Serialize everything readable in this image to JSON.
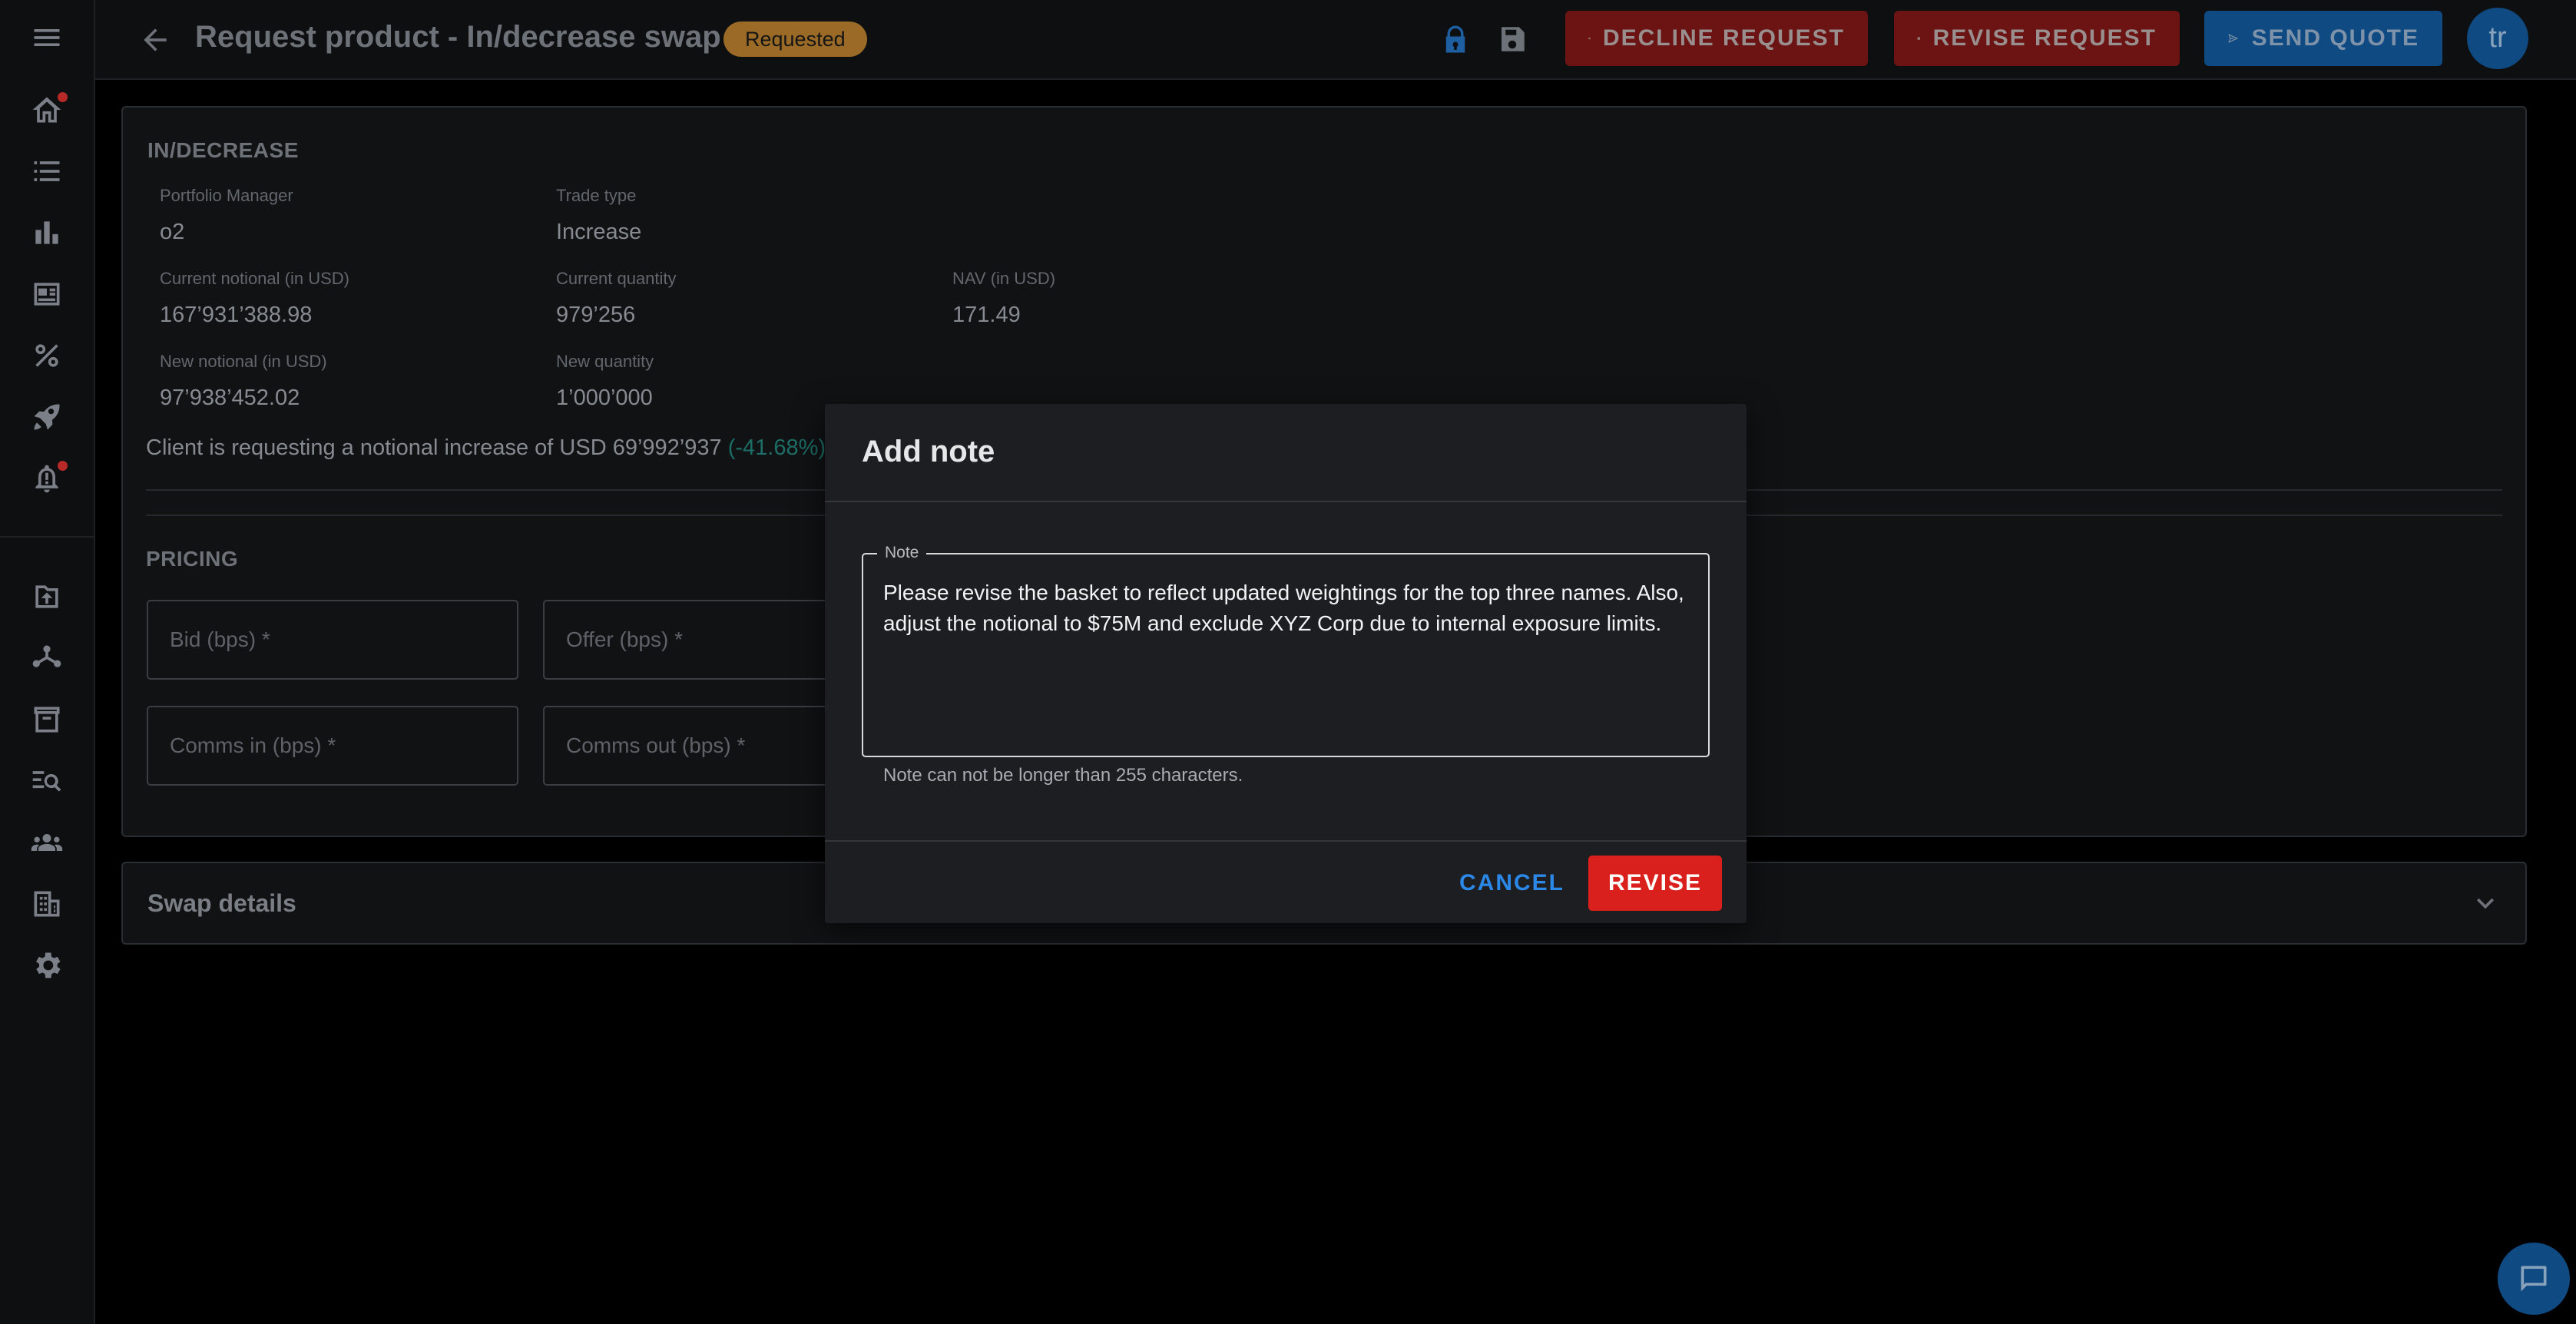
{
  "header": {
    "title": "Request product - In/decrease swap",
    "status": "Requested",
    "decline_label": "DECLINE REQUEST",
    "revise_label": "REVISE REQUEST",
    "send_label": "SEND QUOTE",
    "avatar_initials": "tr"
  },
  "sidebar": {
    "icons": [
      "menu-icon",
      "home-icon",
      "list-icon",
      "bar-chart-icon",
      "newspaper-icon",
      "percent-icon",
      "rocket-icon",
      "bell-icon",
      "upload-icon",
      "network-icon",
      "archive-icon",
      "search-list-icon",
      "groups-icon",
      "building-icon",
      "gear-icon"
    ]
  },
  "indecrease": {
    "section_title": "IN/DECREASE",
    "pm_label": "Portfolio Manager",
    "pm_value": "o2",
    "trade_type_label": "Trade type",
    "trade_type_value": "Increase",
    "current_notional_label": "Current notional (in USD)",
    "current_notional_value": "167’931’388.98",
    "current_quantity_label": "Current quantity",
    "current_quantity_value": "979’256",
    "nav_label": "NAV (in USD)",
    "nav_value": "171.49",
    "new_notional_label": "New notional (in USD)",
    "new_notional_value": "97’938’452.02",
    "new_quantity_label": "New quantity",
    "new_quantity_value": "1’000’000",
    "request_text": "Client is requesting a notional increase of USD 69’992’937",
    "request_pct": "(-41.68%)"
  },
  "pricing": {
    "section_title": "PRICING",
    "bid_placeholder": "Bid (bps) *",
    "offer_placeholder": "Offer (bps) *",
    "comms_in_placeholder": "Comms in (bps) *",
    "comms_out_placeholder": "Comms out (bps) *"
  },
  "swap_details": {
    "title": "Swap details"
  },
  "modal": {
    "title": "Add note",
    "note_label": "Note",
    "note_value": "Please revise the basket to reflect updated weightings for the top three names. Also, adjust the notional to $75M and exclude XYZ Corp due to internal exposure limits.",
    "helper": "Note can not be longer than 255 characters.",
    "cancel_label": "CANCEL",
    "revise_label": "REVISE"
  },
  "colors": {
    "decline": "#6b1413",
    "send": "#0f4a82",
    "revise_primary": "#d9201d",
    "cancel_text": "#2b88e6",
    "status_badge": "#9a6a26",
    "negative_pct": "#1d6e66"
  }
}
